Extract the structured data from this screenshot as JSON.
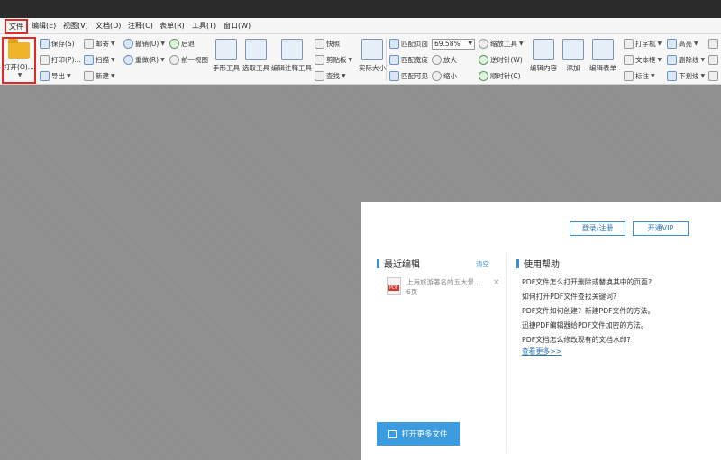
{
  "menu": {
    "file": "文件",
    "edit": "编辑(E)",
    "view": "视图(V)",
    "document": "文档(D)",
    "annotate": "注释(C)",
    "form": "表单(R)",
    "tools": "工具(T)",
    "window": "窗口(W)"
  },
  "ribbon": {
    "open": "打开(O)...",
    "save": "保存(S)",
    "print": "打印(P)...",
    "export": "导出",
    "mail": "邮寄",
    "scan": "扫描",
    "new": "新建",
    "undo": "撤销(U)",
    "redo": "重做(R)",
    "back": "后退",
    "prev_view": "前一视图",
    "hand_tool": "手形工具",
    "select_tool": "选取工具",
    "edit_annot_tool": "编辑注释工具",
    "snapshot": "快照",
    "clipboard": "剪贴板",
    "find": "查找",
    "actual_size": "实际大小",
    "fit_page": "匹配页面",
    "fit_width": "匹配宽度",
    "fit_visible": "匹配可见",
    "zoom_value": "69.58%",
    "zoom_in": "放大",
    "zoom_out": "缩小",
    "zoom_tool": "缩放工具",
    "rotate_ccw": "逆时针(W)",
    "rotate_cw": "顺时针(C)",
    "edit_content": "编辑内容",
    "add": "添加",
    "edit_form": "编辑表单",
    "typewriter": "打字机",
    "textbox": "文本框",
    "callout": "标注",
    "highlight": "高亮",
    "strikeout": "删除线",
    "underline": "下划线"
  },
  "panel": {
    "login": "登录/注册",
    "vip": "开通VIP",
    "recent_title": "最近编辑",
    "clear": "清空",
    "recent_files": [
      {
        "name": "上海旅游著名的五大景...",
        "pages": "6页"
      }
    ],
    "help_title": "使用帮助",
    "help_items": [
      "PDF文件怎么打开删除或替换其中的页面?",
      "如何打开PDF文件查找关键词?",
      "PDF文件如何创建？新建PDF文件的方法。",
      "迅捷PDF编辑器给PDF文件加密的方法。",
      "PDF文档怎么修改现有的文档水印?"
    ],
    "more": "查看更多>>",
    "open_more": "打开更多文件"
  }
}
